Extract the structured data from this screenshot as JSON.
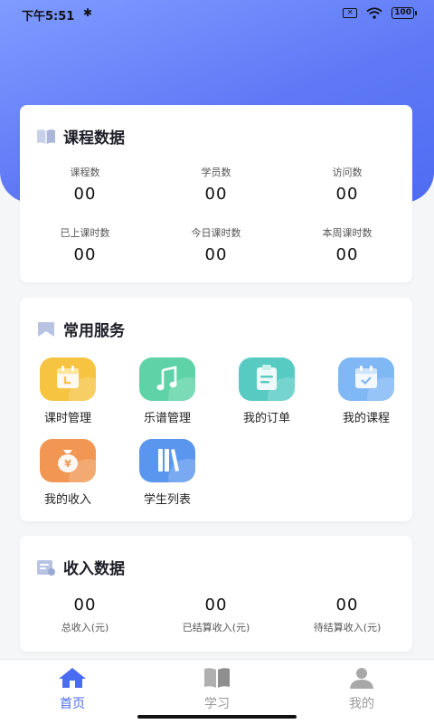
{
  "status": {
    "time": "下午5:51",
    "bluetooth": "✱",
    "battery": "100"
  },
  "colors": {
    "primary": "#4a6cf0",
    "hero_start": "#7f9cff",
    "hero_end": "#4f6cf2"
  },
  "course_card": {
    "title": "课程数据",
    "stats": [
      {
        "label": "课程数",
        "value": "00"
      },
      {
        "label": "学员数",
        "value": "00"
      },
      {
        "label": "访问数",
        "value": "00"
      },
      {
        "label": "已上课时数",
        "value": "00"
      },
      {
        "label": "今日课时数",
        "value": "00"
      },
      {
        "label": "本周课时数",
        "value": "00"
      }
    ]
  },
  "services_card": {
    "title": "常用服务",
    "items": [
      {
        "label": "课时管理",
        "icon": "calendar-icon",
        "color": "#f6c441"
      },
      {
        "label": "乐谱管理",
        "icon": "music-note-icon",
        "color": "#5fd3a7"
      },
      {
        "label": "我的订单",
        "icon": "clipboard-icon",
        "color": "#57cbc2"
      },
      {
        "label": "我的课程",
        "icon": "calendar-check-icon",
        "color": "#7fb8f4"
      },
      {
        "label": "我的收入",
        "icon": "money-bag-icon",
        "color": "#f19653"
      },
      {
        "label": "学生列表",
        "icon": "books-icon",
        "color": "#5b96ee"
      }
    ]
  },
  "income_card": {
    "title": "收入数据",
    "stats": [
      {
        "label": "总收入(元)",
        "value": "00"
      },
      {
        "label": "已结算收入(元)",
        "value": "00"
      },
      {
        "label": "待结算收入(元)",
        "value": "00"
      }
    ]
  },
  "tabs": [
    {
      "label": "首页",
      "icon": "home-icon",
      "active": true
    },
    {
      "label": "学习",
      "icon": "book-icon",
      "active": false
    },
    {
      "label": "我的",
      "icon": "user-icon",
      "active": false
    }
  ]
}
